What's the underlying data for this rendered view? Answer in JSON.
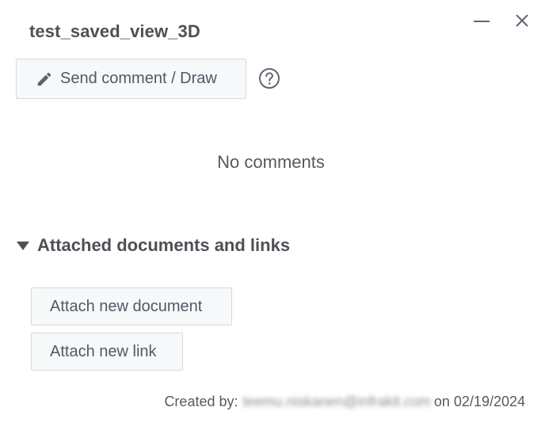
{
  "dialog": {
    "title": "test_saved_view_3D"
  },
  "window_controls": {
    "minimize_icon": "minimize-icon",
    "close_icon": "close-icon"
  },
  "comments": {
    "send_button_label": "Send comment / Draw",
    "send_button_icon": "pencil-icon",
    "help_icon": "help-circle-icon",
    "empty_text": "No comments"
  },
  "attachments": {
    "section_title": "Attached documents and links",
    "toggle_icon": "triangle-down-icon",
    "attach_document_label": "Attach new document",
    "attach_link_label": "Attach new link"
  },
  "footer": {
    "created_by_label": "Created by:",
    "creator_email": "teemu.niskanen@infrakit.com",
    "date_prefix": "on",
    "created_date": "02/19/2024"
  },
  "colors": {
    "text": "#4d5156",
    "button_bg": "#f7f8f9",
    "button_border": "#d8dadd",
    "icon": "#5f6670"
  }
}
